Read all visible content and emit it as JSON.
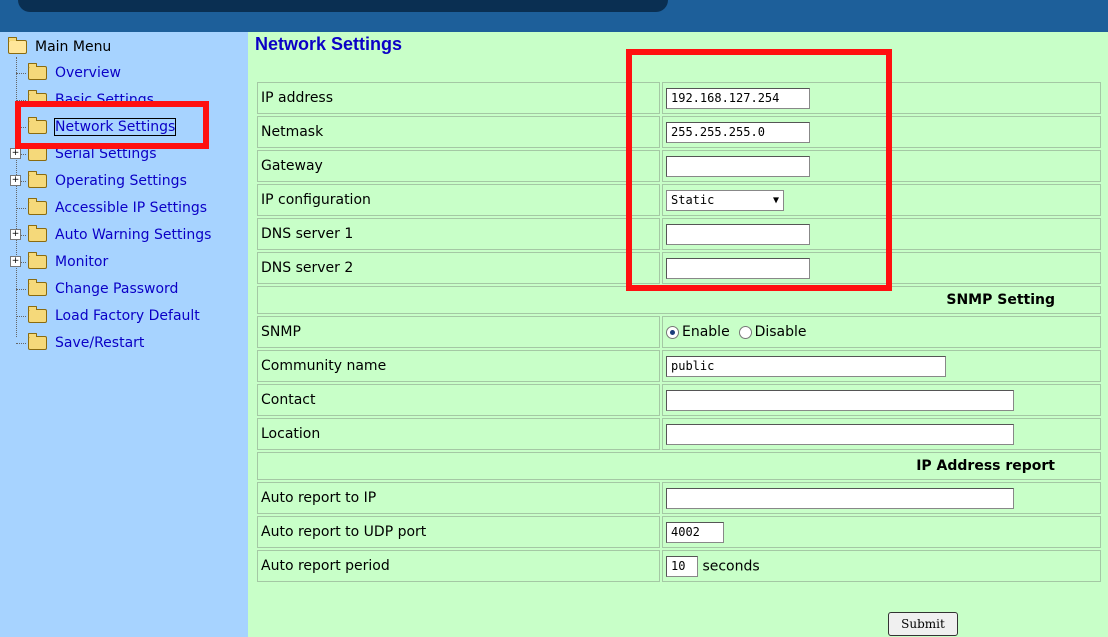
{
  "colors": {
    "accent": "#0b00c6",
    "highlight_box": "#ff1010",
    "sidebar_bg": "#a7d3ff",
    "content_bg": "#c8ffc8",
    "topbar": "#1d5f9a"
  },
  "sidebar": {
    "root_label": "Main Menu",
    "items": [
      {
        "label": "Overview",
        "expandable": false
      },
      {
        "label": "Basic Settings",
        "expandable": false
      },
      {
        "label": "Network Settings",
        "expandable": false,
        "selected": true
      },
      {
        "label": "Serial Settings",
        "expandable": true
      },
      {
        "label": "Operating Settings",
        "expandable": true
      },
      {
        "label": "Accessible IP Settings",
        "expandable": false
      },
      {
        "label": "Auto Warning Settings",
        "expandable": true
      },
      {
        "label": "Monitor",
        "expandable": true
      },
      {
        "label": "Change Password",
        "expandable": false
      },
      {
        "label": "Load Factory Default",
        "expandable": false
      },
      {
        "label": "Save/Restart",
        "expandable": false
      }
    ]
  },
  "main": {
    "title": "Network Settings",
    "ip_address": {
      "label": "IP address",
      "value": "192.168.127.254"
    },
    "netmask": {
      "label": "Netmask",
      "value": "255.255.255.0"
    },
    "gateway": {
      "label": "Gateway",
      "value": ""
    },
    "ip_config": {
      "label": "IP configuration",
      "value": "Static"
    },
    "dns1": {
      "label": "DNS server 1",
      "value": ""
    },
    "dns2": {
      "label": "DNS server 2",
      "value": ""
    },
    "snmp_section": "SNMP Setting",
    "snmp": {
      "label": "SNMP",
      "enable": "Enable",
      "disable": "Disable",
      "selected": "Enable"
    },
    "community": {
      "label": "Community name",
      "value": "public"
    },
    "contact": {
      "label": "Contact",
      "value": ""
    },
    "location": {
      "label": "Location",
      "value": ""
    },
    "ip_report_section": "IP Address report",
    "auto_ip": {
      "label": "Auto report to IP",
      "value": ""
    },
    "auto_port": {
      "label": "Auto report to UDP port",
      "value": "4002"
    },
    "auto_period": {
      "label": "Auto report period",
      "value": "10",
      "unit": "seconds"
    },
    "submit": "Submit"
  }
}
